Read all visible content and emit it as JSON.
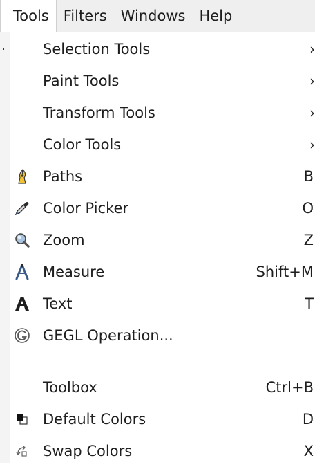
{
  "menubar": {
    "items": [
      "Tools",
      "Filters",
      "Windows",
      "Help"
    ]
  },
  "menu": {
    "items": [
      {
        "label": "Selection Tools",
        "shortcut": "",
        "submenu": true,
        "icon": ""
      },
      {
        "label": "Paint Tools",
        "shortcut": "",
        "submenu": true,
        "icon": ""
      },
      {
        "label": "Transform Tools",
        "shortcut": "",
        "submenu": true,
        "icon": ""
      },
      {
        "label": "Color Tools",
        "shortcut": "",
        "submenu": true,
        "icon": ""
      },
      {
        "label": "Paths",
        "shortcut": "B",
        "submenu": false,
        "icon": "pen-nib-icon"
      },
      {
        "label": "Color Picker",
        "shortcut": "O",
        "submenu": false,
        "icon": "eyedropper-icon"
      },
      {
        "label": "Zoom",
        "shortcut": "Z",
        "submenu": false,
        "icon": "magnifier-icon"
      },
      {
        "label": "Measure",
        "shortcut": "Shift+M",
        "submenu": false,
        "icon": "compass-icon"
      },
      {
        "label": "Text",
        "shortcut": "T",
        "submenu": false,
        "icon": "text-a-icon"
      },
      {
        "label": "GEGL Operation...",
        "shortcut": "",
        "submenu": false,
        "icon": "gegl-icon"
      },
      {
        "label": "Toolbox",
        "shortcut": "Ctrl+B",
        "submenu": false,
        "icon": ""
      },
      {
        "label": "Default Colors",
        "shortcut": "D",
        "submenu": false,
        "icon": "default-colors-icon"
      },
      {
        "label": "Swap Colors",
        "shortcut": "X",
        "submenu": false,
        "icon": "swap-colors-icon"
      }
    ],
    "submenu_arrow": "›"
  },
  "colors": {
    "menubar_bg": "#efefef",
    "menu_bg": "#ffffff",
    "text": "#1e1e1e",
    "separator": "#dcdcdc"
  }
}
